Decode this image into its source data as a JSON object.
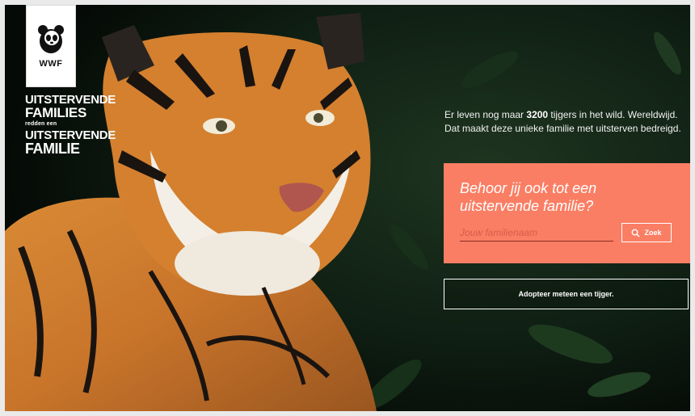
{
  "brand": {
    "logo_text": "WWF"
  },
  "tagline": {
    "line1": "UITSTERVENDE",
    "line2": "FAMILIES",
    "line3": "redden een",
    "line4": "UITSTERVENDE",
    "line5": "FAMILIE"
  },
  "intro": {
    "prefix": "Er leven nog maar ",
    "number": "3200",
    "suffix": " tijgers in het wild. Wereldwijd. Dat maakt deze unieke familie met uitsterven bedreigd."
  },
  "panel": {
    "title": "Behoor jij ook tot een uitstervende familie?",
    "input_placeholder": "Jouw familienaam",
    "search_label": "Zoek",
    "search_icon": "search-icon"
  },
  "adopt": {
    "label": "Adopteer meteen een tijger."
  },
  "colors": {
    "accent": "#fa7e64",
    "background": "#0b140e"
  }
}
